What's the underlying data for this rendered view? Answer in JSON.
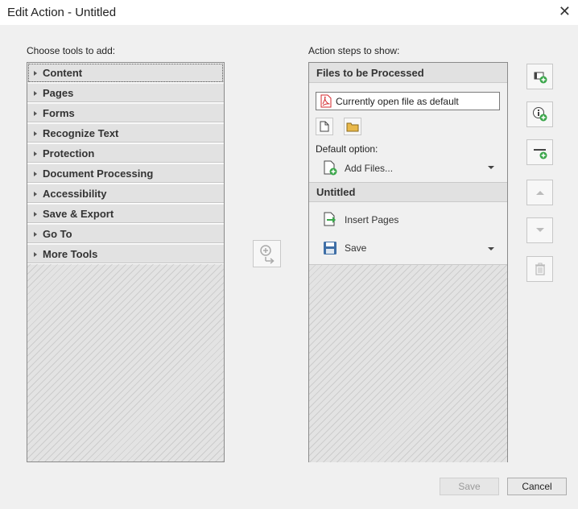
{
  "window": {
    "title": "Edit Action - Untitled",
    "close_glyph": "✕"
  },
  "left": {
    "heading": "Choose tools to add:",
    "tools": [
      "Content",
      "Pages",
      "Forms",
      "Recognize Text",
      "Protection",
      "Document Processing",
      "Accessibility",
      "Save & Export",
      "Go To",
      "More Tools"
    ]
  },
  "right": {
    "heading": "Action steps to show:",
    "files_section": "Files to be Processed",
    "current_file": "Currently open file as default",
    "default_option_label": "Default option:",
    "add_files": "Add Files...",
    "untitled_section": "Untitled",
    "steps": [
      "Insert Pages",
      "Save"
    ]
  },
  "buttons": {
    "save": "Save",
    "cancel": "Cancel"
  },
  "colors": {
    "pdf_red": "#d4282e",
    "green_plus": "#3aa64a",
    "folder": "#e8b84a"
  }
}
